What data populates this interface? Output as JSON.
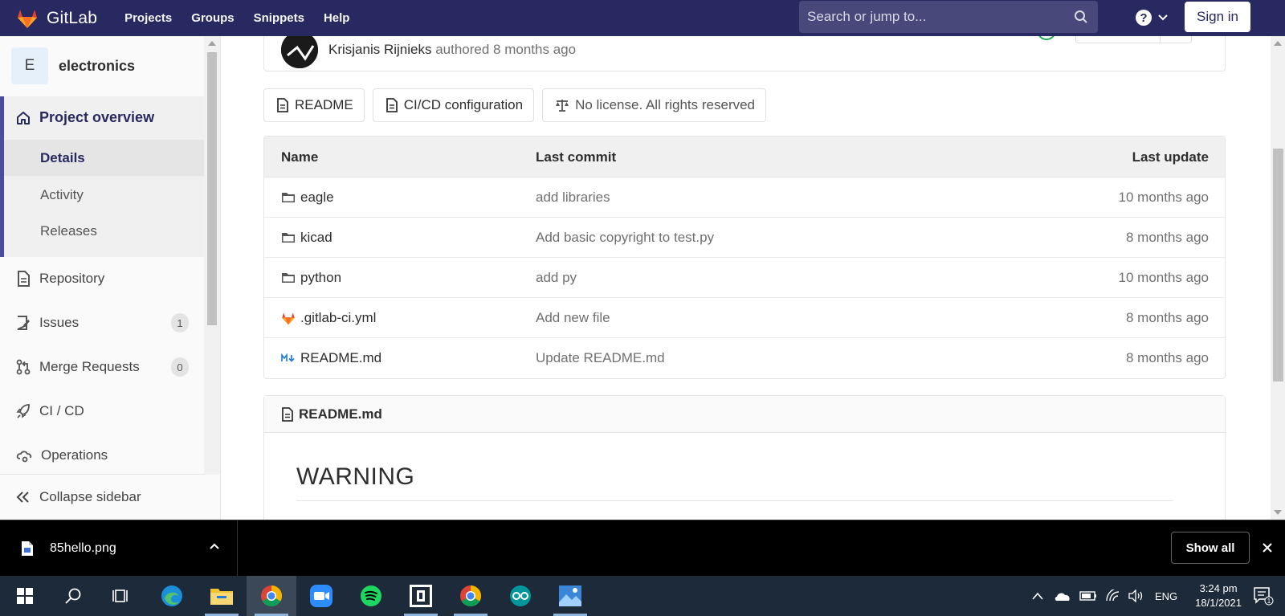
{
  "nav": {
    "brand": "GitLab",
    "links": [
      "Projects",
      "Groups",
      "Snippets",
      "Help"
    ],
    "search_placeholder": "Search or jump to...",
    "sign_in": "Sign in",
    "brand_color": "#292961"
  },
  "sidebar": {
    "project_initial": "E",
    "project_name": "electronics",
    "overview_label": "Project overview",
    "overview_items": [
      "Details",
      "Activity",
      "Releases"
    ],
    "items": [
      {
        "label": "Repository",
        "icon": "document-icon"
      },
      {
        "label": "Issues",
        "icon": "issues-icon",
        "count": "1"
      },
      {
        "label": "Merge Requests",
        "icon": "merge-request-icon",
        "count": "0"
      },
      {
        "label": "CI / CD",
        "icon": "rocket-icon"
      },
      {
        "label": "Operations",
        "icon": "cloud-gear-icon"
      }
    ],
    "collapse_label": "Collapse sidebar"
  },
  "commit": {
    "author": "Krisjanis Rijnieks",
    "meta": "authored 8 months ago"
  },
  "pills": [
    "README",
    "CI/CD configuration",
    "No license. All rights reserved"
  ],
  "files": {
    "headers": {
      "name": "Name",
      "commit": "Last commit",
      "update": "Last update"
    },
    "rows": [
      {
        "name": "eagle",
        "type": "folder",
        "commit": "add libraries",
        "update": "10 months ago"
      },
      {
        "name": "kicad",
        "type": "folder",
        "commit": "Add basic copyright to test.py",
        "update": "8 months ago"
      },
      {
        "name": "python",
        "type": "folder",
        "commit": "add py",
        "update": "10 months ago"
      },
      {
        "name": ".gitlab-ci.yml",
        "type": "gitlab",
        "commit": "Add new file",
        "update": "8 months ago"
      },
      {
        "name": "README.md",
        "type": "markdown",
        "commit": "Update README.md",
        "update": "8 months ago"
      }
    ]
  },
  "readme": {
    "filename": "README.md",
    "heading": "WARNING"
  },
  "downloads": {
    "file": "85hello.png",
    "show_all": "Show all"
  },
  "taskbar": {
    "lang": "ENG",
    "time": "3:24 pm",
    "date": "18/1/2021"
  }
}
